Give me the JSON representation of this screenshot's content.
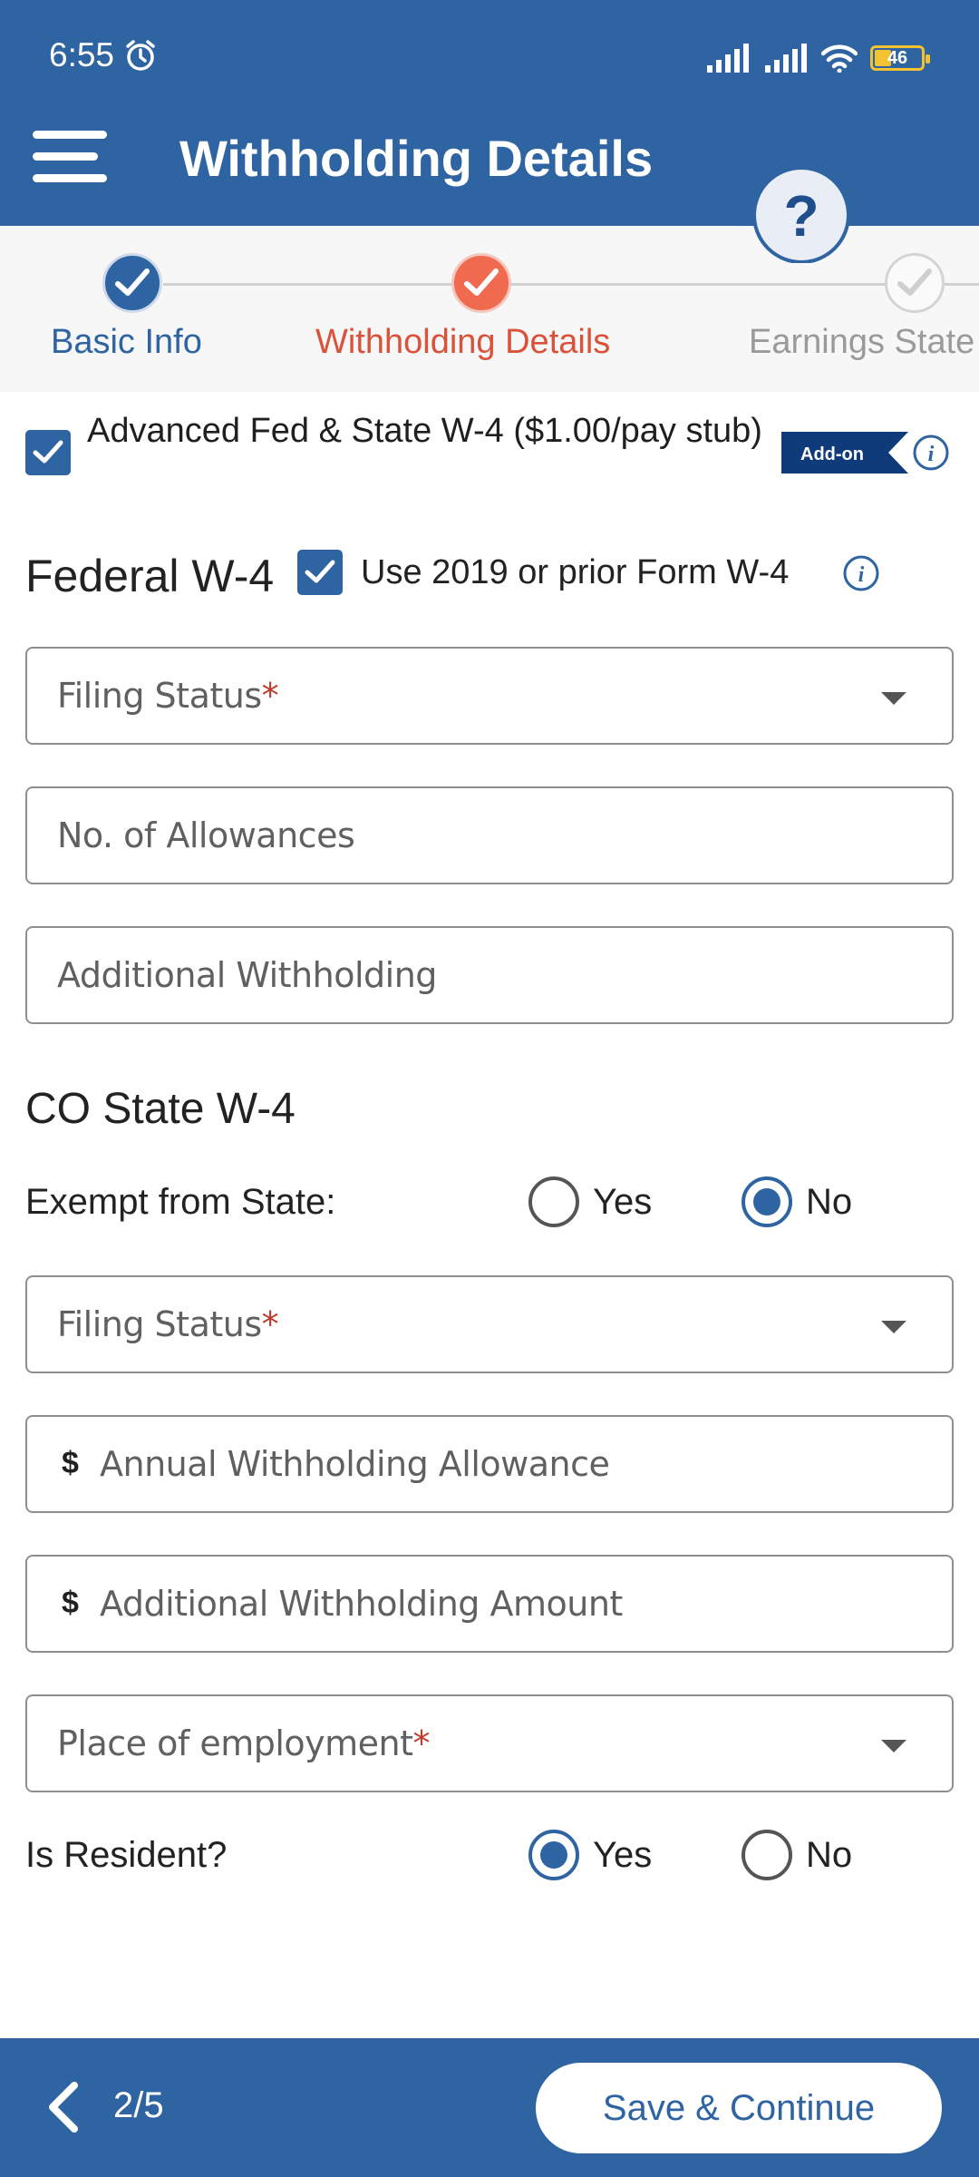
{
  "status_bar": {
    "time": "6:55",
    "battery": "46"
  },
  "app_bar": {
    "title": "Withholding Details",
    "help_glyph": "?"
  },
  "stepper": {
    "steps": [
      {
        "label": "Basic Info",
        "state": "done",
        "color": "#2f64a3"
      },
      {
        "label": "Withholding Details",
        "state": "current",
        "color": "#e4593f"
      },
      {
        "label": "Earnings State",
        "state": "pending",
        "color": "#9a9a9a"
      }
    ]
  },
  "addon": {
    "label": "Advanced Fed & State W-4 ($1.00/pay stub)",
    "checked": true,
    "badge": "Add-on"
  },
  "federal": {
    "title": "Federal W-4",
    "use_prior_label": "Use 2019 or prior Form W-4",
    "use_prior_checked": true,
    "filing_status": {
      "placeholder": "Filing Status",
      "required_mark": "*"
    },
    "allowances": {
      "placeholder": "No. of Allowances"
    },
    "additional_withholding": {
      "placeholder": "Additional Withholding"
    }
  },
  "state": {
    "title": "CO State W-4",
    "exempt_label": "Exempt from State:",
    "exempt_options": [
      {
        "label": "Yes",
        "selected": false
      },
      {
        "label": "No",
        "selected": true
      }
    ],
    "filing_status": {
      "placeholder": "Filing Status",
      "required_mark": "*"
    },
    "annual_allowance": {
      "currency": "$",
      "placeholder": "Annual Withholding Allowance"
    },
    "additional_amount": {
      "currency": "$",
      "placeholder": "Additional Withholding Amount"
    },
    "place_of_employment": {
      "placeholder": "Place of employment",
      "required_mark": "*"
    },
    "resident_label": "Is Resident?",
    "resident_options": [
      {
        "label": "Yes",
        "selected": true
      },
      {
        "label": "No",
        "selected": false
      }
    ]
  },
  "footer": {
    "page_indicator": "2/5",
    "save_label": "Save & Continue"
  },
  "colors": {
    "primary": "#2f64a3",
    "accent": "#e4593f",
    "required": "#c0392b",
    "navy_badge": "#0f3b7a"
  }
}
